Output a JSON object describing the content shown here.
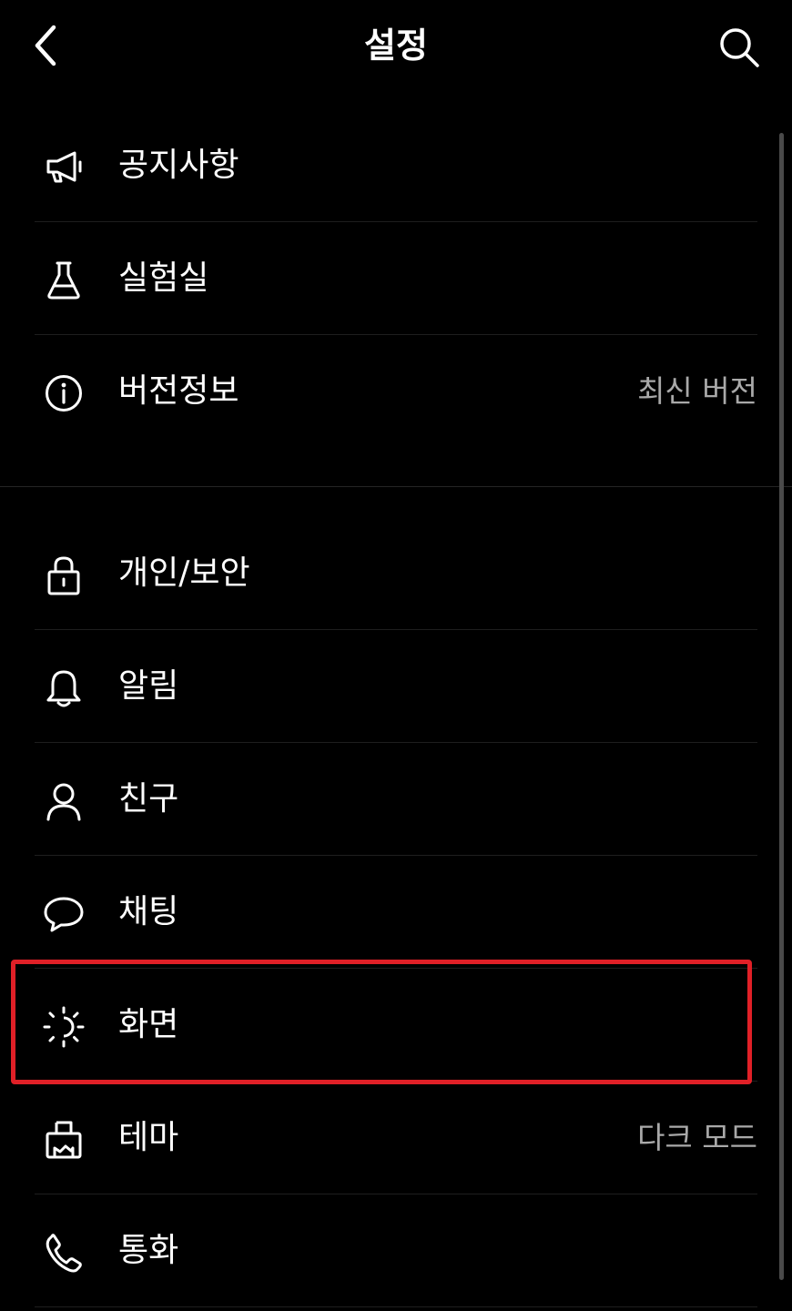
{
  "header": {
    "title": "설정",
    "back_icon": "chevron-left-icon",
    "search_icon": "search-icon"
  },
  "groups": [
    {
      "items": [
        {
          "label": "공지사항",
          "icon": "megaphone-icon",
          "value": ""
        },
        {
          "label": "실험실",
          "icon": "flask-icon",
          "value": ""
        },
        {
          "label": "버전정보",
          "icon": "info-icon",
          "value": "최신 버전"
        }
      ]
    },
    {
      "items": [
        {
          "label": "개인/보안",
          "icon": "lock-icon",
          "value": ""
        },
        {
          "label": "알림",
          "icon": "bell-icon",
          "value": ""
        },
        {
          "label": "친구",
          "icon": "person-icon",
          "value": ""
        },
        {
          "label": "채팅",
          "icon": "chat-bubble-icon",
          "value": ""
        },
        {
          "label": "화면",
          "icon": "display-brightness-icon",
          "value": "",
          "highlighted": true
        },
        {
          "label": "테마",
          "icon": "paint-brush-icon",
          "value": "다크 모드"
        },
        {
          "label": "통화",
          "icon": "phone-icon",
          "value": ""
        }
      ]
    }
  ],
  "colors": {
    "background": "#000000",
    "text": "#ffffff",
    "secondary_text": "#a9a9a9",
    "highlight": "#e02027"
  }
}
